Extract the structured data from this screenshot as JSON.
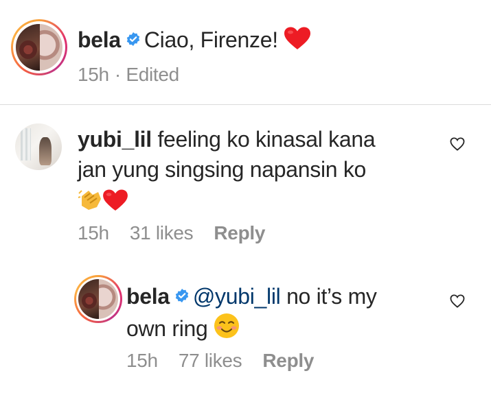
{
  "caption": {
    "username": "bela",
    "text": "Ciao, Firenze!",
    "time": "15h",
    "edited": "· Edited"
  },
  "comment": {
    "username": "yubi_lil",
    "line1": "feeling ko kinasal kana",
    "line2": "jan yung singsing napansin ko",
    "time": "15h",
    "likes": "31 likes",
    "reply": "Reply"
  },
  "reply_comment": {
    "username": "bela",
    "mention": "@yubi_lil",
    "line1": "no it’s my",
    "line2": "own ring",
    "time": "15h",
    "likes": "77 likes",
    "reply": "Reply"
  },
  "icons": {
    "verified": "verified-badge-icon",
    "heart_like": "heart-outline-icon",
    "red_heart": "red-heart-emoji",
    "clap": "clapping-hands-emoji",
    "smile": "smiling-face-emoji"
  },
  "colors": {
    "verified": "#3897f0",
    "mention": "#00376b",
    "meta": "#8e8e8e",
    "heart": "#ed1c24"
  }
}
